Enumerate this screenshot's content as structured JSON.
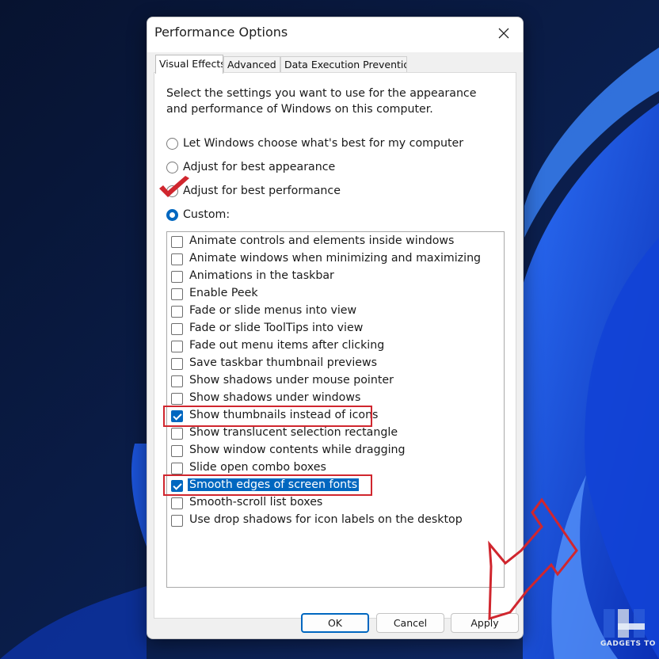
{
  "dialog": {
    "title": "Performance Options",
    "close_icon": "close-icon"
  },
  "tabs": [
    {
      "label": "Visual Effects",
      "active": true
    },
    {
      "label": "Advanced",
      "active": false
    },
    {
      "label": "Data Execution Prevention",
      "active": false
    }
  ],
  "visual_effects": {
    "description": "Select the settings you want to use for the appearance and performance of Windows on this computer.",
    "radio_options": [
      {
        "label": "Let Windows choose what's best for my computer",
        "selected": false
      },
      {
        "label": "Adjust for best appearance",
        "selected": false
      },
      {
        "label": "Adjust for best performance",
        "selected": false
      },
      {
        "label": "Custom:",
        "selected": true
      }
    ],
    "effects": [
      {
        "label": "Animate controls and elements inside windows",
        "checked": false
      },
      {
        "label": "Animate windows when minimizing and maximizing",
        "checked": false
      },
      {
        "label": "Animations in the taskbar",
        "checked": false
      },
      {
        "label": "Enable Peek",
        "checked": false
      },
      {
        "label": "Fade or slide menus into view",
        "checked": false
      },
      {
        "label": "Fade or slide ToolTips into view",
        "checked": false
      },
      {
        "label": "Fade out menu items after clicking",
        "checked": false
      },
      {
        "label": "Save taskbar thumbnail previews",
        "checked": false
      },
      {
        "label": "Show shadows under mouse pointer",
        "checked": false
      },
      {
        "label": "Show shadows under windows",
        "checked": false
      },
      {
        "label": "Show thumbnails instead of icons",
        "checked": true
      },
      {
        "label": "Show translucent selection rectangle",
        "checked": false
      },
      {
        "label": "Show window contents while dragging",
        "checked": false
      },
      {
        "label": "Slide open combo boxes",
        "checked": false
      },
      {
        "label": "Smooth edges of screen fonts",
        "checked": true,
        "highlighted": true
      },
      {
        "label": "Smooth-scroll list boxes",
        "checked": false
      },
      {
        "label": "Use drop shadows for icon labels on the desktop",
        "checked": false
      }
    ]
  },
  "buttons": {
    "ok": "OK",
    "cancel": "Cancel",
    "apply": "Apply"
  },
  "annotations": {
    "color": "#d0262e",
    "checkmark_icon": "red-checkmark-icon",
    "arrow_icon": "red-arrow-icon"
  },
  "watermark": {
    "logo_icon": "gadgets-logo-icon",
    "text": "GADGETS TO USE"
  },
  "colors": {
    "accent": "#0067c0",
    "wallpaper_dark": "#0a1a3d",
    "wallpaper_blue": "#1f5ff0"
  }
}
